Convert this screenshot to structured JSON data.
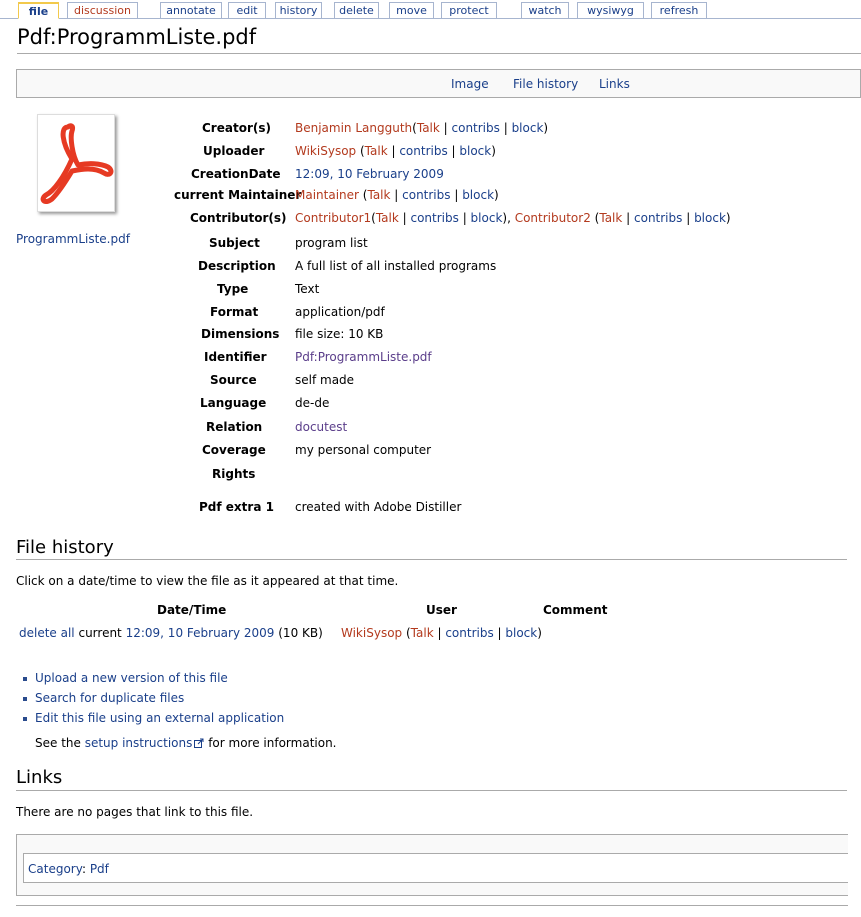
{
  "tabs": [
    {
      "label": "file"
    },
    {
      "label": "discussion"
    },
    {
      "label": "annotate"
    },
    {
      "label": "edit"
    },
    {
      "label": "history"
    },
    {
      "label": "delete"
    },
    {
      "label": "move"
    },
    {
      "label": "protect"
    },
    {
      "label": "watch"
    },
    {
      "label": "wysiwyg"
    },
    {
      "label": "refresh"
    }
  ],
  "page_title": "Pdf:ProgrammListe.pdf",
  "filetoc": [
    "Image",
    "File history",
    "Links"
  ],
  "thumbnail": {
    "icon": "pdf-icon",
    "caption": "ProgrammListe.pdf"
  },
  "meta": {
    "creator": {
      "label": "Creator(s)",
      "name": "Benjamin Langguth"
    },
    "uploader": {
      "label": "Uploader",
      "name": "WikiSysop"
    },
    "creation_date": {
      "label": "CreationDate",
      "value": "12:09, 10 February 2009"
    },
    "maintainer": {
      "label": "current Maintainer",
      "name": "Maintainer"
    },
    "contributors": {
      "label": "Contributor(s)",
      "name1": "Contributor1",
      "name2": "Contributor2"
    },
    "user_links": {
      "talk": "Talk",
      "contribs": "contribs",
      "block": "block"
    },
    "subject": {
      "label": "Subject",
      "value": "program list"
    },
    "description": {
      "label": "Description",
      "value": "A full list of all installed programs"
    },
    "type": {
      "label": "Type",
      "value": "Text"
    },
    "format": {
      "label": "Format",
      "value": "application/pdf"
    },
    "dimensions": {
      "label": "Dimensions",
      "value": "file size: 10 KB"
    },
    "identifier": {
      "label": "Identifier",
      "value": "Pdf:ProgrammListe.pdf"
    },
    "source": {
      "label": "Source",
      "value": "self made"
    },
    "language": {
      "label": "Language",
      "value": "de-de"
    },
    "relation": {
      "label": "Relation",
      "value": "docutest"
    },
    "coverage": {
      "label": "Coverage",
      "value": "my personal computer"
    },
    "rights": {
      "label": "Rights",
      "value": ""
    },
    "pdf_extra": {
      "label": "Pdf extra 1",
      "value": "created with Adobe Distiller"
    }
  },
  "file_history": {
    "heading": "File history",
    "intro": "Click on a date/time to view the file as it appeared at that time.",
    "columns": [
      "Date/Time",
      "User",
      "Comment"
    ],
    "row": {
      "delete_all": "delete all",
      "current": "current",
      "datetime": "12:09, 10 February 2009",
      "size": "(10 KB)",
      "user": "WikiSysop",
      "talk": "Talk",
      "contribs": "contribs",
      "block": "block"
    },
    "actions": [
      "Upload a new version of this file",
      "Search for duplicate files",
      "Edit this file using an external application"
    ],
    "see_the": "See the",
    "setup_link": "setup instructions",
    "for_more": "for more information."
  },
  "links": {
    "heading": "Links",
    "text": "There are no pages that link to this file."
  },
  "category": {
    "label": "Category",
    "value": "Pdf"
  }
}
